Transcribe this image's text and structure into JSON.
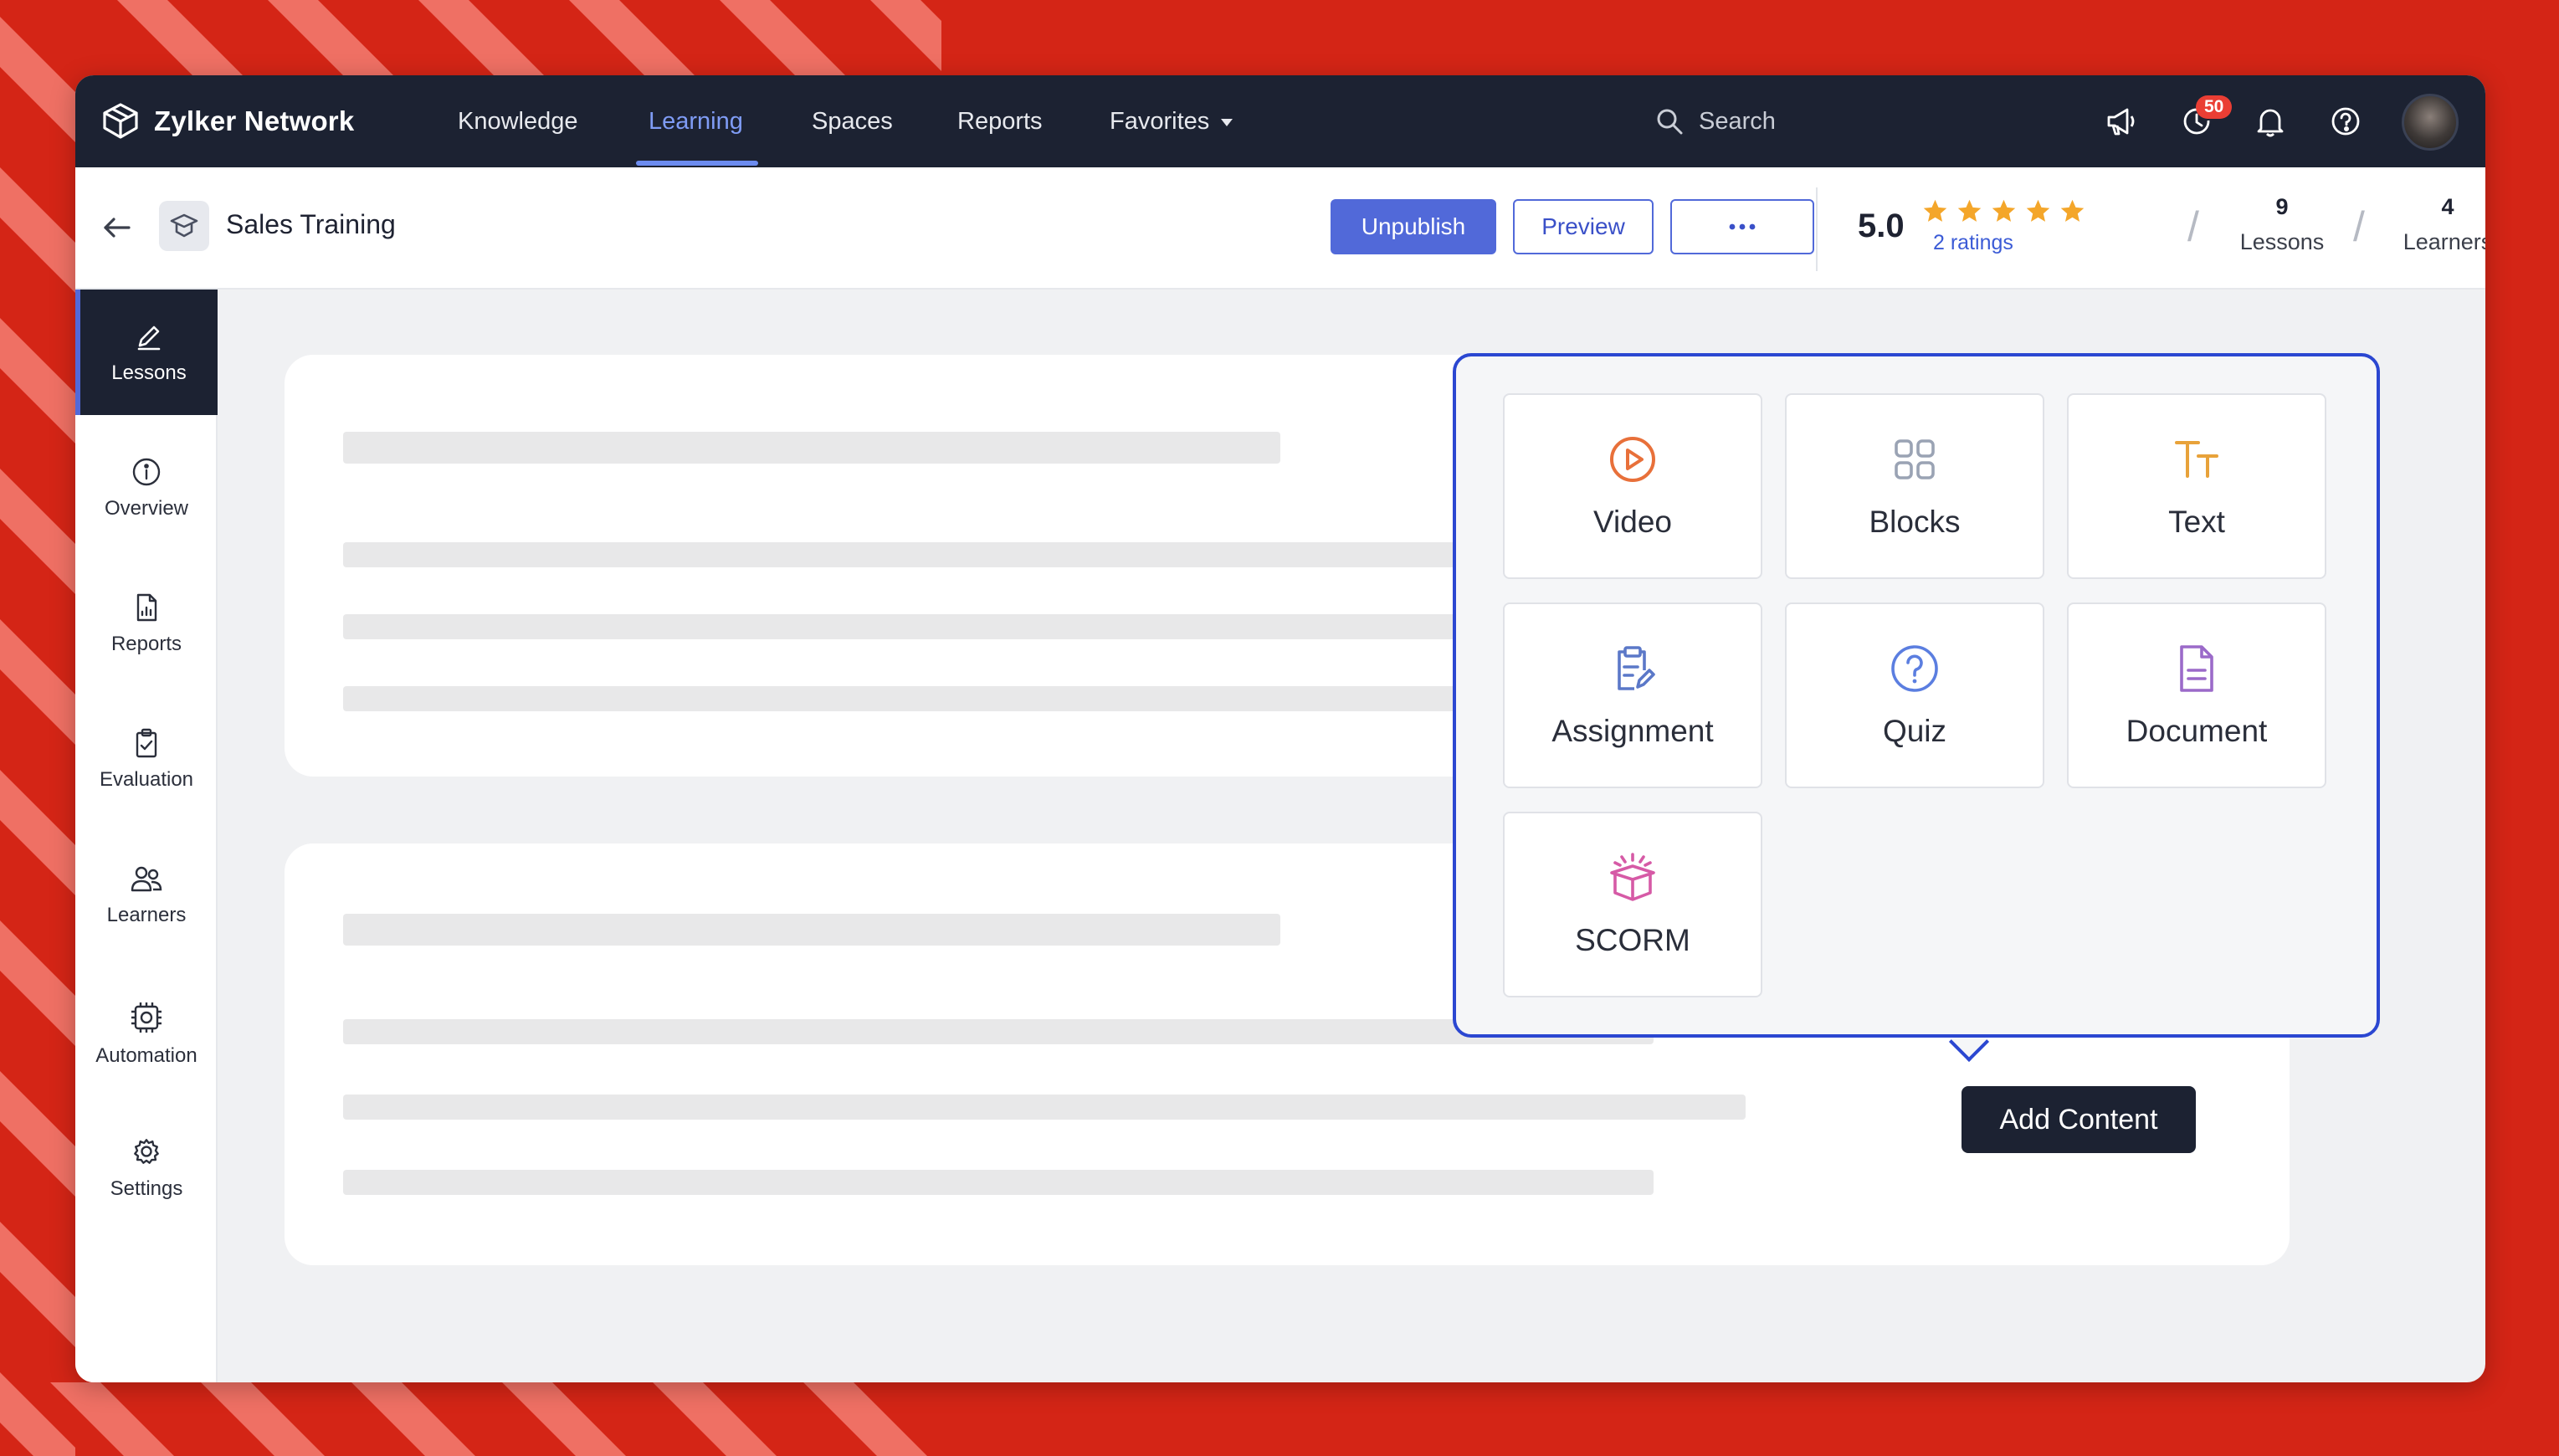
{
  "app": {
    "brand": "Zylker Network",
    "nav": [
      {
        "label": "Knowledge"
      },
      {
        "label": "Learning"
      },
      {
        "label": "Spaces"
      },
      {
        "label": "Reports"
      },
      {
        "label": "Favorites"
      }
    ],
    "active_nav": "Learning",
    "search_placeholder": "Search",
    "notification_count": "50"
  },
  "course": {
    "title": "Sales Training",
    "unpublish_label": "Unpublish",
    "preview_label": "Preview",
    "more_label": "•••",
    "rating_score": "5.0",
    "rating_stars": 5,
    "ratings_link": "2 ratings",
    "lessons_count": "9",
    "lessons_label": "Lessons",
    "learners_count": "4",
    "learners_label": "Learners"
  },
  "sidebar": {
    "items": [
      {
        "label": "Lessons",
        "icon": "pencil-icon",
        "active": true
      },
      {
        "label": "Overview",
        "icon": "info-icon"
      },
      {
        "label": "Reports",
        "icon": "report-icon"
      },
      {
        "label": "Evaluation",
        "icon": "clipboard-check-icon"
      },
      {
        "label": "Learners",
        "icon": "users-icon"
      },
      {
        "label": "Automation",
        "icon": "chip-icon"
      },
      {
        "label": "Settings",
        "icon": "gear-icon"
      }
    ]
  },
  "add_content": {
    "tooltip": "Add Content",
    "tiles": [
      {
        "label": "Video",
        "icon": "video-play-icon",
        "color": "#e8703a"
      },
      {
        "label": "Blocks",
        "icon": "blocks-grid-icon",
        "color": "#9aa3b4"
      },
      {
        "label": "Text",
        "icon": "text-tt-icon",
        "color": "#e8a23a"
      },
      {
        "label": "Assignment",
        "icon": "assignment-icon",
        "color": "#5b78c8"
      },
      {
        "label": "Quiz",
        "icon": "quiz-question-icon",
        "color": "#5b7ee0"
      },
      {
        "label": "Document",
        "icon": "document-icon",
        "color": "#9b6ac9"
      },
      {
        "label": "SCORM",
        "icon": "scorm-box-icon",
        "color": "#d65aa6"
      }
    ]
  },
  "colors": {
    "frame": "#d42516",
    "navbar": "#1c2232",
    "accent": "#5169d9",
    "popover_border": "#2b47d1",
    "star": "#f4a62a"
  }
}
